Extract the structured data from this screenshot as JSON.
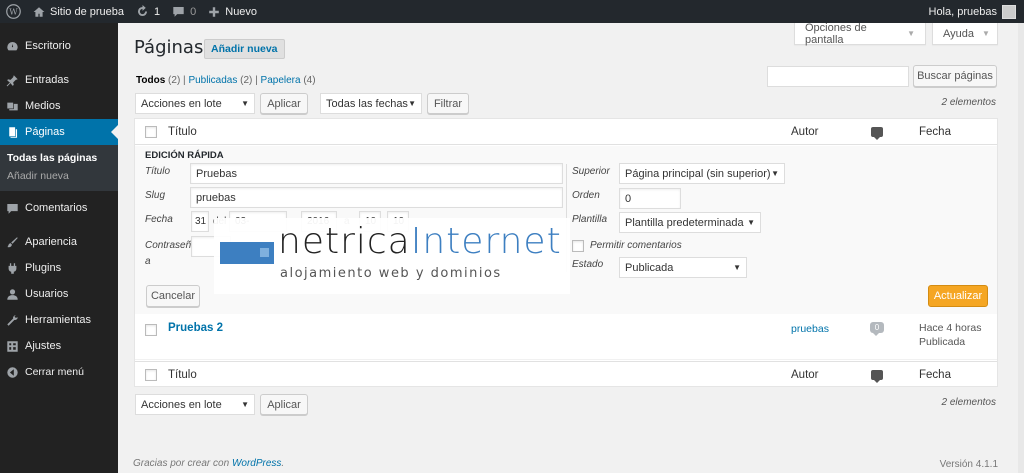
{
  "adminbar": {
    "site_name": "Sitio de prueba",
    "updates_count": "1",
    "comments_count": "0",
    "new_label": "Nuevo",
    "greeting": "Hola, pruebas"
  },
  "menu": {
    "escritorio": "Escritorio",
    "entradas": "Entradas",
    "medios": "Medios",
    "paginas": "Páginas",
    "sub_all": "Todas las páginas",
    "sub_new": "Añadir nueva",
    "comentarios": "Comentarios",
    "apariencia": "Apariencia",
    "plugins": "Plugins",
    "usuarios": "Usuarios",
    "herramientas": "Herramientas",
    "ajustes": "Ajustes",
    "cerrar": "Cerrar menú"
  },
  "header": {
    "screen_options": "Opciones de pantalla",
    "help": "Ayuda",
    "title": "Páginas",
    "add_new": "Añadir nueva"
  },
  "filters": {
    "all_label": "Todos",
    "all_count": "(2)",
    "published_label": "Publicadas",
    "published_count": "(2)",
    "trash_label": "Papelera",
    "trash_count": "(4)",
    "search_button": "Buscar páginas",
    "search_value": "",
    "bulk_actions": "Acciones en lote",
    "apply": "Aplicar",
    "all_dates": "Todas las fechas",
    "filter": "Filtrar",
    "item_count": "2 elementos"
  },
  "table": {
    "col_title": "Título",
    "col_author": "Autor",
    "col_date": "Fecha"
  },
  "quick_edit": {
    "heading": "EDICIÓN RÁPIDA",
    "title_label": "Título",
    "title_value": "Pruebas",
    "slug_label": "Slug",
    "slug_value": "pruebas",
    "date_label": "Fecha",
    "day": "31",
    "del": "del",
    "month": "03-",
    "year": "2016",
    "at": "a",
    "hour": "10",
    "minute": "10",
    "password_label": "Contraseñ a",
    "parent_label": "Superior",
    "parent_value": "Página principal (sin superior)",
    "order_label": "Orden",
    "order_value": "0",
    "template_label": "Plantilla",
    "template_value": "Plantilla predeterminada",
    "allow_comments": "Permitir comentarios",
    "status_label": "Estado",
    "status_value": "Publicada",
    "cancel": "Cancelar",
    "update": "Actualizar"
  },
  "watermark": {
    "brand_a": "netrica",
    "brand_b": "Internet",
    "tagline": "alojamiento web y dominios"
  },
  "rows": [
    {
      "title": "Pruebas 2",
      "author": "pruebas",
      "comments": "0",
      "date": "Hace 4 horas",
      "status": "Publicada"
    }
  ],
  "footer": {
    "thanks": "Gracias por crear con",
    "wp_link": "WordPress",
    "version": "Versión 4.1.1"
  },
  "colors": {
    "menu_bg": "#222222",
    "accent": "#0073aa",
    "update_button": "#f5a623"
  }
}
